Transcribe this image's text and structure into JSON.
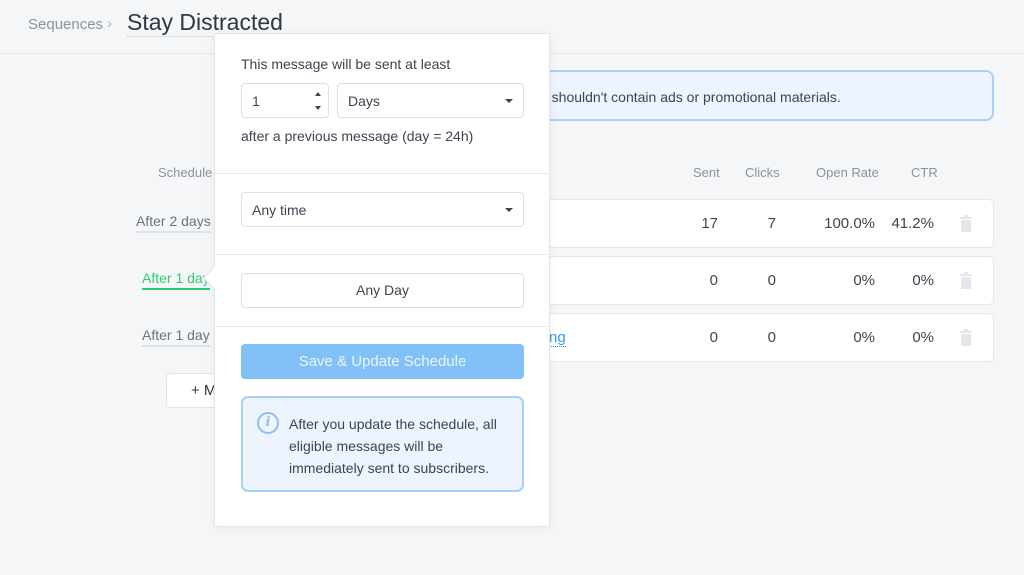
{
  "breadcrumb": {
    "root": "Sequences",
    "separator": "›",
    "title": "Stay Distracted"
  },
  "notice": {
    "text": "e shouldn't contain ads or promotional materials."
  },
  "table": {
    "headers": {
      "schedule": "Schedule",
      "sent": "Sent",
      "clicks": "Clicks",
      "open_rate": "Open Rate",
      "ctr": "CTR"
    },
    "rows": [
      {
        "schedule": "After 2 days",
        "title": "",
        "sent": "17",
        "clicks": "7",
        "open_rate": "100.0%",
        "ctr": "41.2%"
      },
      {
        "schedule": "After 1 day",
        "title": "",
        "sent": "0",
        "clicks": "0",
        "open_rate": "0%",
        "ctr": "0%",
        "active": true
      },
      {
        "schedule": "After 1 day",
        "title": "ng",
        "sent": "0",
        "clicks": "0",
        "open_rate": "0%",
        "ctr": "0%"
      }
    ],
    "add_button": "+ M"
  },
  "popover": {
    "intro": "This message will be sent at least",
    "amount": "1",
    "unit": "Days",
    "suffix": "after a previous message (day = 24h)",
    "time": "Any time",
    "day": "Any Day",
    "save_label": "Save & Update Schedule",
    "info": "After you update the schedule, all eligible messages will be immediately sent to subscribers."
  }
}
